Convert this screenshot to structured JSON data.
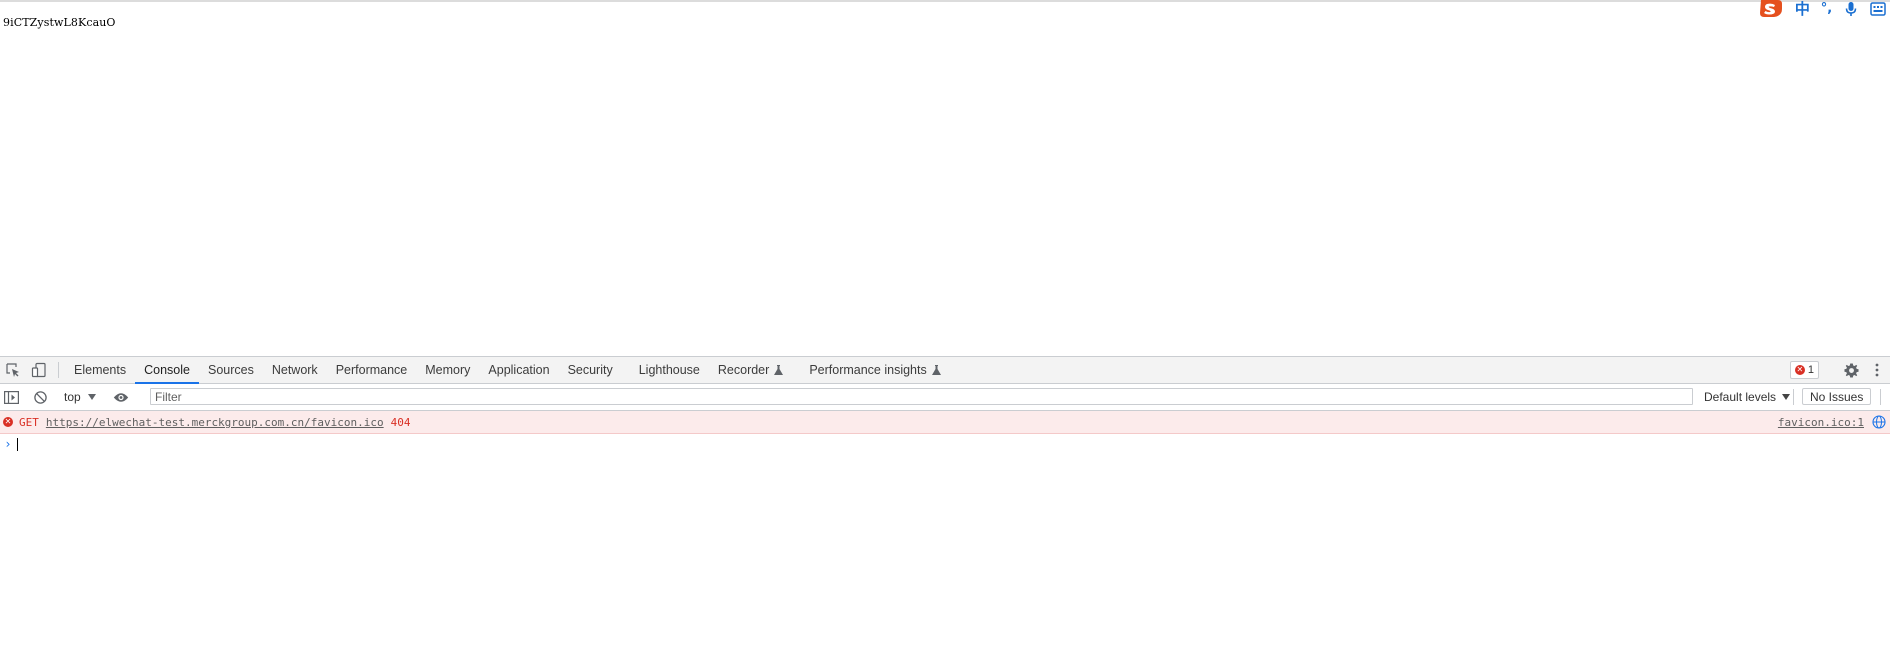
{
  "page": {
    "text": "9iCTZystwL8KcauO"
  },
  "ime": {
    "mode_label": "中",
    "punct_label": "°,",
    "icons": [
      "sogou-logo-icon",
      "punctuation-icon",
      "microphone-icon",
      "keyboard-icon"
    ]
  },
  "devtools": {
    "tabs": [
      {
        "label": "Elements"
      },
      {
        "label": "Console",
        "active": true
      },
      {
        "label": "Sources"
      },
      {
        "label": "Network"
      },
      {
        "label": "Performance"
      },
      {
        "label": "Memory"
      },
      {
        "label": "Application"
      },
      {
        "label": "Security"
      },
      {
        "label": "Lighthouse"
      },
      {
        "label": "Recorder",
        "experimental": true
      },
      {
        "label": "Performance insights",
        "experimental": true
      }
    ],
    "error_count": "1",
    "colors": {
      "accent": "#1a73e8",
      "error": "#d93025",
      "error_bg": "#fcebeb"
    }
  },
  "console": {
    "context": "top",
    "filter_placeholder": "Filter",
    "levels_label": "Default levels",
    "issues_label": "No Issues",
    "messages": [
      {
        "level": "error",
        "method": "GET",
        "url": "https://elwechat-test.merckgroup.com.cn/favicon.ico",
        "status": "404",
        "source": "favicon.ico:1"
      }
    ],
    "prompt": "›"
  }
}
